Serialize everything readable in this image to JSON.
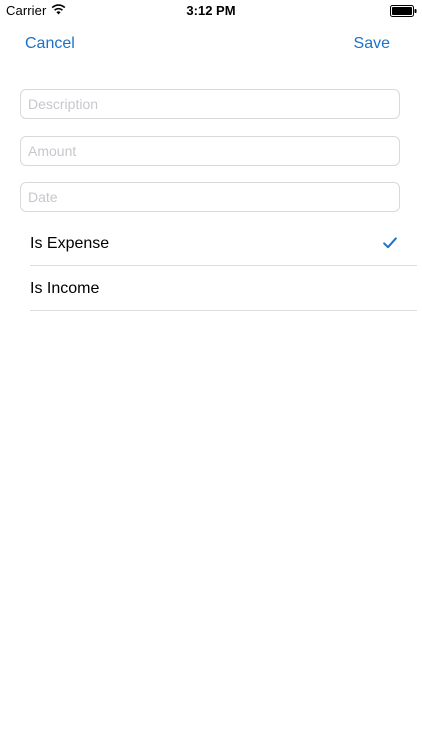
{
  "status_bar": {
    "carrier": "Carrier",
    "time": "3:12 PM",
    "wifi_icon": "wifi-icon",
    "battery_icon": "battery-full-icon"
  },
  "nav": {
    "cancel_label": "Cancel",
    "save_label": "Save"
  },
  "form": {
    "description": {
      "placeholder": "Description",
      "value": ""
    },
    "amount": {
      "placeholder": "Amount",
      "value": ""
    },
    "date": {
      "placeholder": "Date",
      "value": ""
    }
  },
  "type_options": [
    {
      "label": "Is Expense",
      "selected": true
    },
    {
      "label": "Is Income",
      "selected": false
    }
  ],
  "colors": {
    "accent": "#1a73c8",
    "field_border": "#d9d9d9",
    "placeholder": "#c7c7cd",
    "separator": "#dcdcdc"
  }
}
